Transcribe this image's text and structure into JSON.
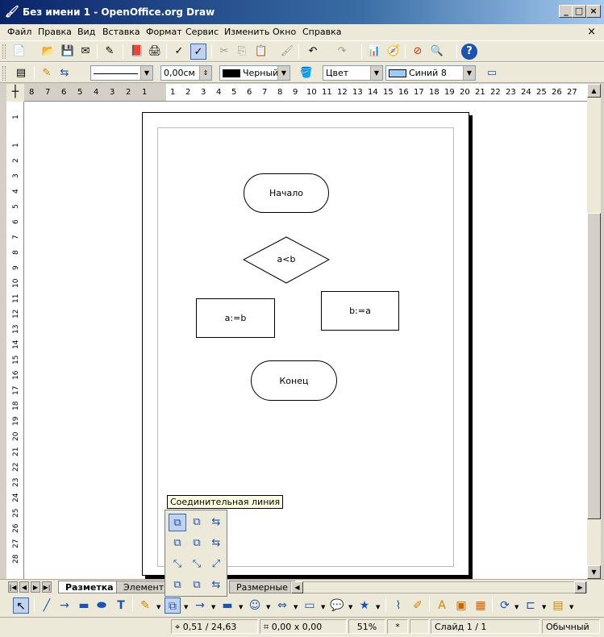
{
  "window": {
    "title": "Без имени 1 - OpenOffice.org Draw",
    "min_label": "_",
    "max_label": "□",
    "close_label": "×"
  },
  "menu": {
    "items": [
      "Файл",
      "Правка",
      "Вид",
      "Вставка",
      "Формат",
      "Сервис",
      "Изменить",
      "Окно",
      "Справка"
    ],
    "close": "×"
  },
  "toolbar2": {
    "line_width": "0,00см",
    "line_color": "Черный",
    "area_style": "Цвет",
    "area_color": "Синий 8",
    "line_color_hex": "#000000",
    "area_color_hex": "#99ccff"
  },
  "ruler": {
    "h_left": [
      "8",
      "7",
      "6",
      "5",
      "4",
      "3",
      "2",
      "1"
    ],
    "h_right": [
      "1",
      "2",
      "3",
      "4",
      "5",
      "6",
      "7",
      "8",
      "9",
      "10",
      "11",
      "12",
      "13",
      "14",
      "15",
      "16",
      "17",
      "18",
      "19",
      "20",
      "21",
      "22",
      "23",
      "24",
      "25",
      "26",
      "27"
    ],
    "v": [
      "1",
      "1",
      "2",
      "3",
      "4",
      "5",
      "6",
      "7",
      "8",
      "9",
      "10",
      "11",
      "12",
      "13",
      "14",
      "15",
      "16",
      "17",
      "18",
      "19",
      "20",
      "21",
      "22",
      "23",
      "24",
      "25",
      "26",
      "27",
      "28"
    ]
  },
  "flowchart": {
    "start": "Начало",
    "condition": "a<b",
    "left_assign": "a:=b",
    "right_assign": "b:=a",
    "end": "Конец"
  },
  "tabs": [
    "Разметка",
    "Элементы",
    "Размерные"
  ],
  "tooltip": "Соединительная линия",
  "status": {
    "position": "0,51 / 24,63",
    "size": "0,00 x 0,00",
    "zoom": "51%",
    "modified": "*",
    "slide": "Слайд 1 / 1",
    "style": "Обычный"
  }
}
